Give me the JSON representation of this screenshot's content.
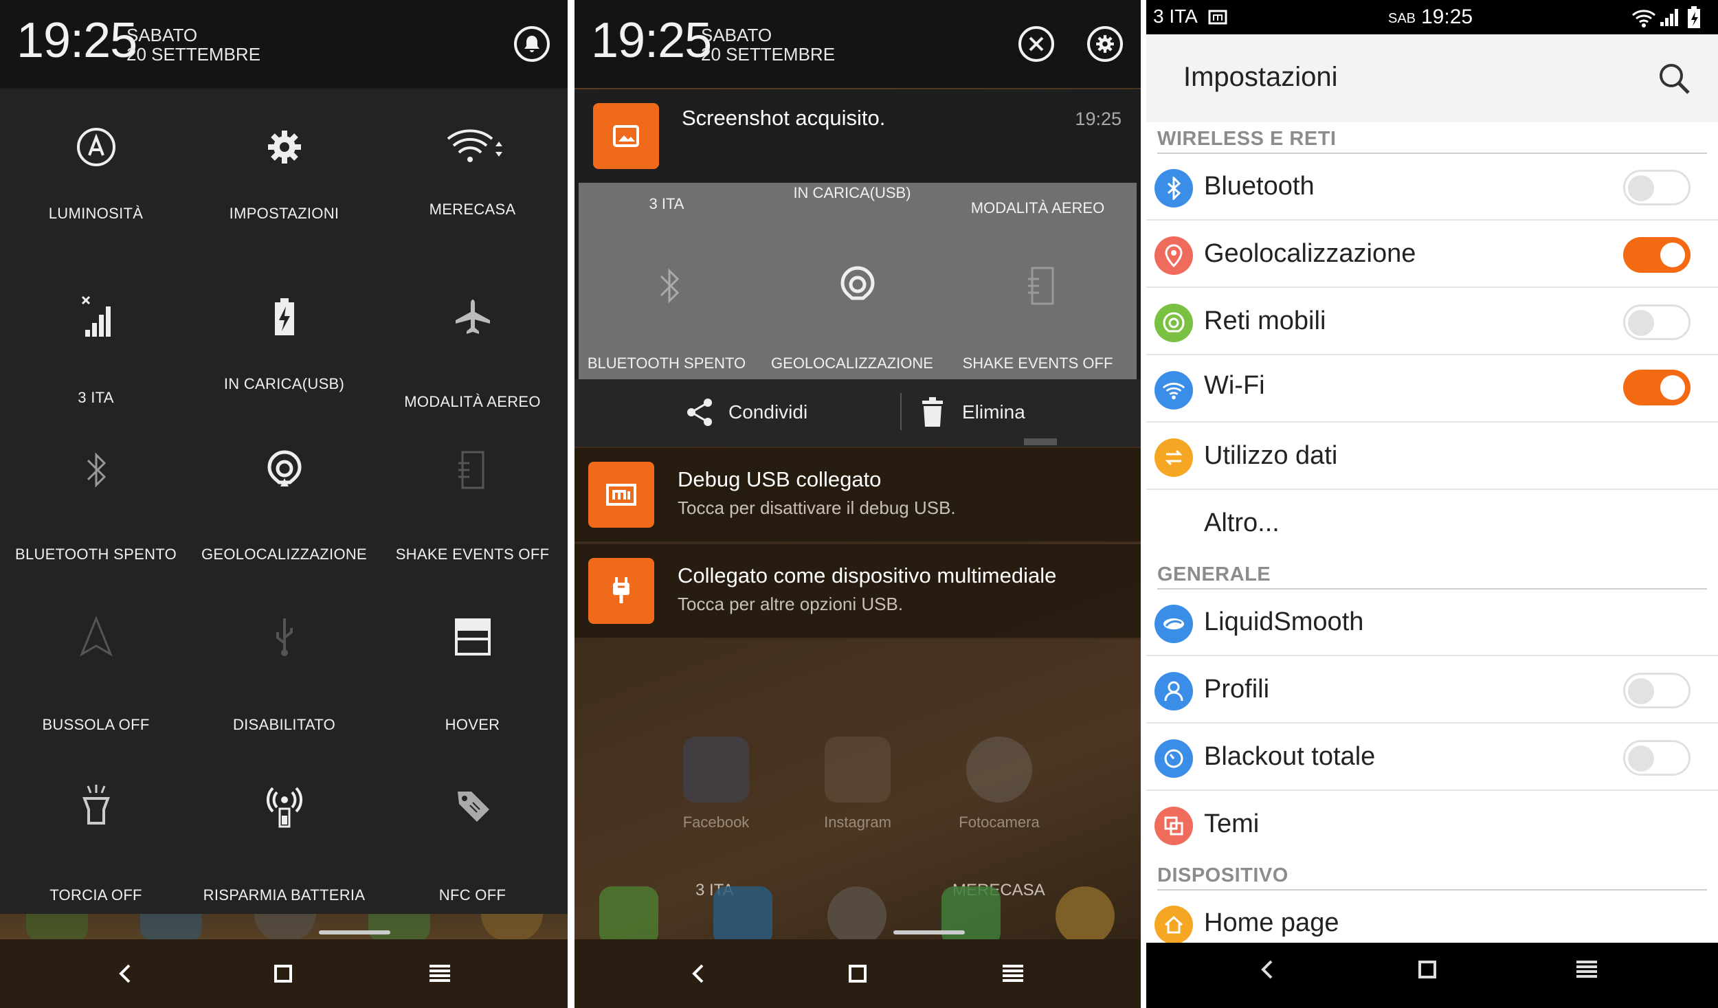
{
  "panel1": {
    "time": "19:25",
    "day": "SABATO",
    "date": "20 SETTEMBRE",
    "toggles": [
      {
        "label": "LUMINOSITÀ",
        "icon": "brightness-auto-icon"
      },
      {
        "label": "IMPOSTAZIONI",
        "icon": "gear-icon"
      },
      {
        "label": "MERECASA",
        "icon": "wifi-icon"
      },
      {
        "label": "3 ITA",
        "icon": "signal-icon"
      },
      {
        "label": "IN CARICA(USB)",
        "icon": "battery-charging-icon"
      },
      {
        "label": "MODALITÀ AEREO",
        "icon": "airplane-icon"
      },
      {
        "label": "BLUETOOTH SPENTO",
        "icon": "bluetooth-icon"
      },
      {
        "label": "GEOLOCALIZZAZIONE",
        "icon": "location-icon"
      },
      {
        "label": "SHAKE EVENTS OFF",
        "icon": "shake-icon"
      },
      {
        "label": "BUSSOLA OFF",
        "icon": "compass-icon"
      },
      {
        "label": "DISABILITATO",
        "icon": "usb-icon"
      },
      {
        "label": "HOVER",
        "icon": "hover-icon"
      },
      {
        "label": "TORCIA OFF",
        "icon": "flashlight-icon"
      },
      {
        "label": "RISPARMIA BATTERIA",
        "icon": "battery-saver-icon"
      },
      {
        "label": "NFC OFF",
        "icon": "nfc-icon"
      }
    ]
  },
  "panel2": {
    "time": "19:25",
    "day": "SABATO",
    "date": "20 SETTEMBRE",
    "screenshot": {
      "title": "Screenshot acquisito.",
      "time": "19:25"
    },
    "grey_top": [
      "3 ITA",
      "IN CARICA(USB)",
      "MODALITÀ AEREO"
    ],
    "grey_bottom": [
      "BLUETOOTH SPENTO",
      "GEOLOCALIZZAZIONE",
      "SHAKE EVENTS OFF"
    ],
    "actions": {
      "share": "Condividi",
      "delete": "Elimina"
    },
    "debug": {
      "title": "Debug USB collegato",
      "sub": "Tocca per disattivare il debug USB."
    },
    "media": {
      "title": "Collegato come dispositivo multimediale",
      "sub": "Tocca per altre opzioni USB."
    },
    "apps": [
      "Facebook",
      "Instagram",
      "Fotocamera"
    ],
    "dock_labels": {
      "left": "3 ITA",
      "right": "MERECASA"
    }
  },
  "panel3": {
    "status": {
      "carrier": "3 ITA",
      "day": "SAB",
      "time": "19:25"
    },
    "title": "Impostazioni",
    "sections": {
      "wireless": "WIRELESS E RETI",
      "general": "GENERALE",
      "device": "DISPOSITIVO"
    },
    "rows": {
      "bluetooth": {
        "label": "Bluetooth",
        "on": false
      },
      "location": {
        "label": "Geolocalizzazione",
        "on": true
      },
      "mobile": {
        "label": "Reti mobili",
        "on": false
      },
      "wifi": {
        "label": "Wi-Fi",
        "on": true
      },
      "data": {
        "label": "Utilizzo dati"
      },
      "more": {
        "label": "Altro..."
      },
      "liquid": {
        "label": "LiquidSmooth"
      },
      "profiles": {
        "label": "Profili",
        "on": false
      },
      "blackout": {
        "label": "Blackout totale",
        "on": false
      },
      "themes": {
        "label": "Temi"
      },
      "home": {
        "label": "Home page"
      }
    }
  },
  "colors": {
    "accent": "#f36a12",
    "dark": "#1d1d1d"
  }
}
